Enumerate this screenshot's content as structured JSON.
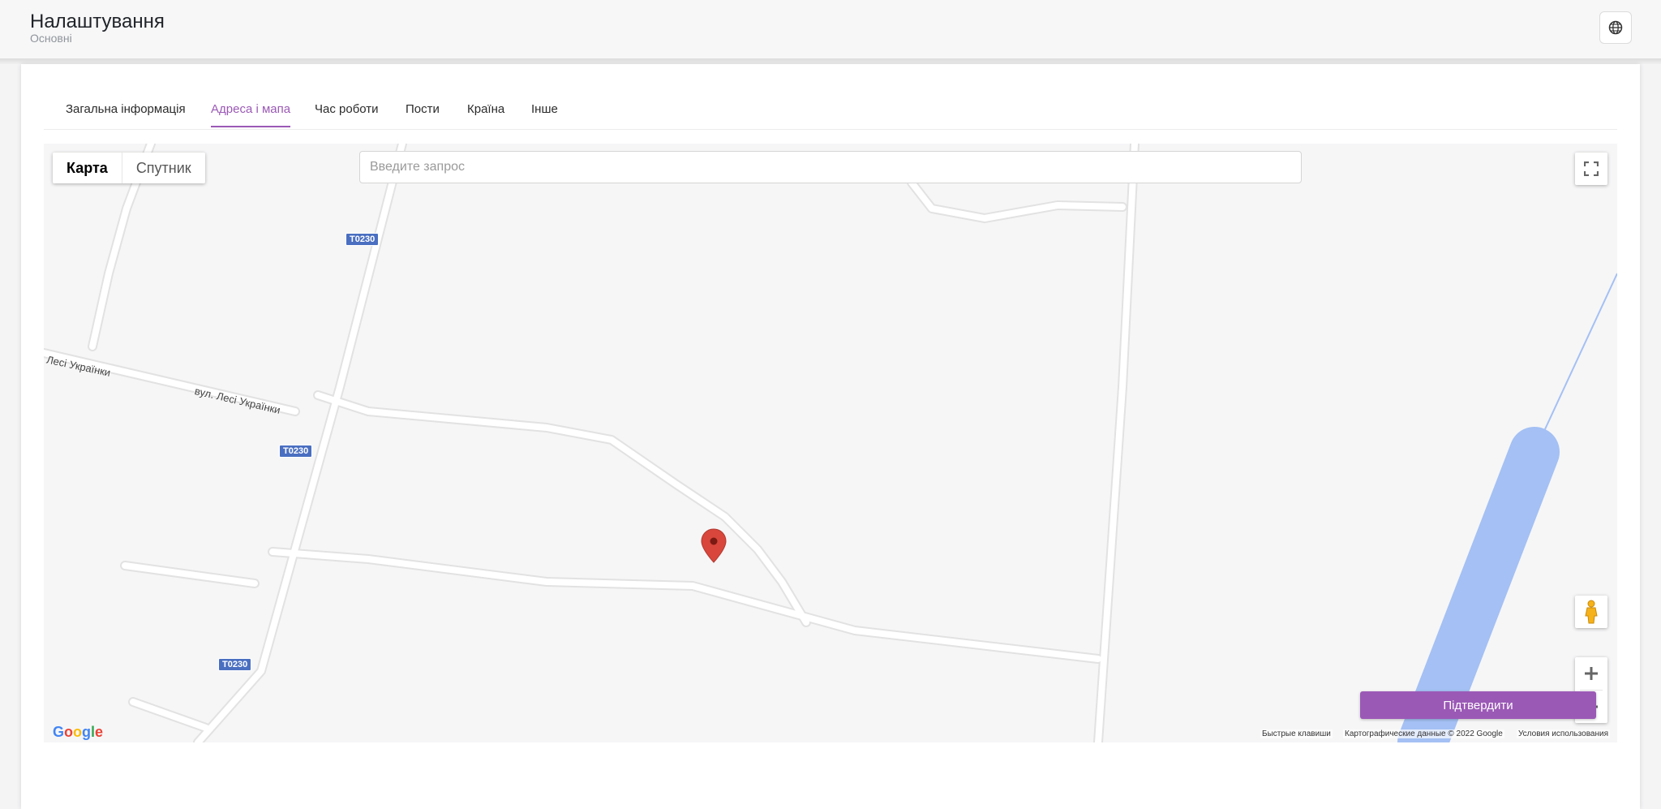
{
  "header": {
    "title": "Налаштування",
    "subtitle": "Основні",
    "globe_icon": "globe-icon"
  },
  "tabs": [
    {
      "label": "Загальна інформація",
      "active": false
    },
    {
      "label": "Адреса і мапа",
      "active": true
    },
    {
      "label": "Час роботи",
      "active": false
    },
    {
      "label": "Пости",
      "active": false
    },
    {
      "label": "Країна",
      "active": false
    },
    {
      "label": "Інше",
      "active": false
    }
  ],
  "map": {
    "type_map": "Карта",
    "type_satellite": "Спутник",
    "search_placeholder": "Введите запрос",
    "route_label": "T0230",
    "street_1": ". Лесі Українки",
    "street_2": "вул. Лесі Українки",
    "google_logo": "Google",
    "keyboard_shortcuts": "Быстрые клавиши",
    "map_data": "Картографические данные © 2022 Google",
    "terms": "Условия использования",
    "icons": [
      "fullscreen-icon",
      "pegman-icon",
      "zoom-in-icon",
      "zoom-out-icon",
      "map-marker-icon"
    ]
  },
  "actions": {
    "confirm": "Підтвердити"
  },
  "colors": {
    "accent": "#9b59b6",
    "marker": "#d9463b",
    "water": "#a4c0f4",
    "route_badge": "#4a6fc1"
  }
}
